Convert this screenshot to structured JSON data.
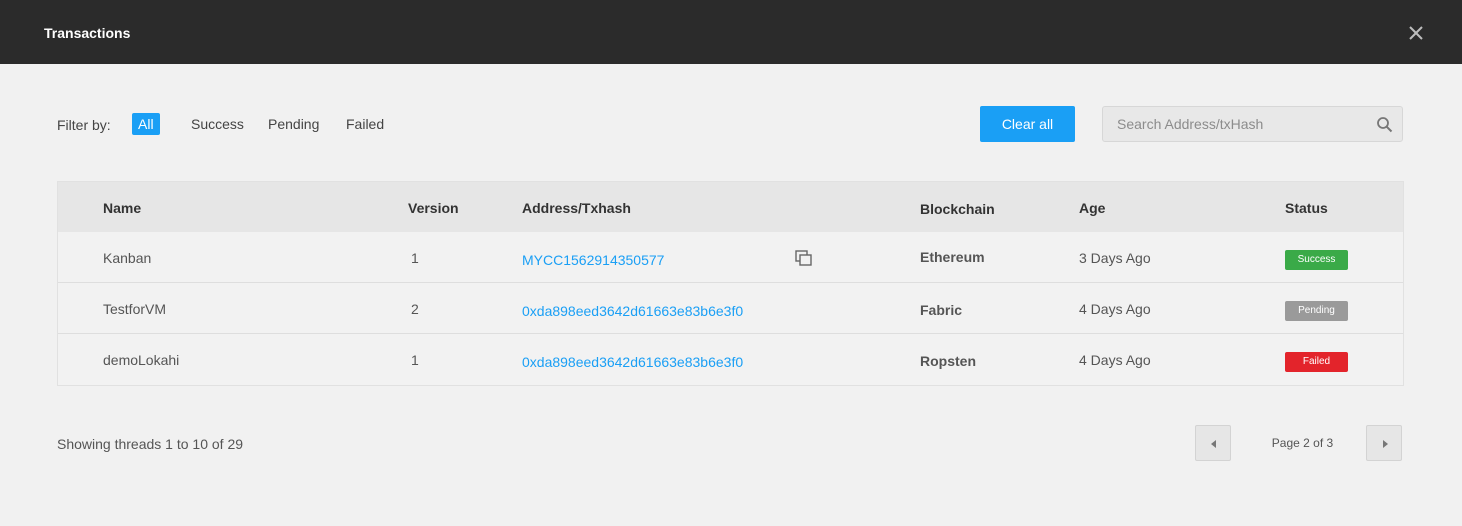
{
  "header": {
    "title": "Transactions",
    "close_icon": "close-icon"
  },
  "filter": {
    "label": "Filter by:",
    "options": [
      "All",
      "Success",
      "Pending",
      "Failed"
    ],
    "selected": "All",
    "active_color": "#1a9ff5"
  },
  "actions": {
    "clear_label": "Clear all"
  },
  "search": {
    "placeholder": "Search Address/txHash",
    "value": "",
    "icon": "search-icon"
  },
  "table": {
    "columns": [
      "Name",
      "Version",
      "Address/Txhash",
      "Blockchain",
      "Age",
      "Status"
    ],
    "rows": [
      {
        "name": "Kanban",
        "version": "1",
        "address": "MYCC1562914350577",
        "has_copy_icon": true,
        "blockchain": "Ethereum",
        "age": "3 Days Ago",
        "status": "Success",
        "status_color": "#3aaa48"
      },
      {
        "name": "TestforVM",
        "version": "2",
        "address": "0xda898eed3642d61663e83b6e3f0",
        "has_copy_icon": false,
        "blockchain": "Fabric",
        "age": "4 Days Ago",
        "status": "Pending",
        "status_color": "#9a9a9a"
      },
      {
        "name": "demoLokahi",
        "version": "1",
        "address": "0xda898eed3642d61663e83b6e3f0",
        "has_copy_icon": false,
        "blockchain": "Ropsten",
        "age": "4 Days Ago",
        "status": "Failed",
        "status_color": "#e3242b"
      }
    ]
  },
  "footer": {
    "showing_text": "Showing threads 1 to 10 of 29",
    "page_text": "Page 2 of 3",
    "prev_icon": "triangle-left-icon",
    "next_icon": "triangle-right-icon"
  }
}
